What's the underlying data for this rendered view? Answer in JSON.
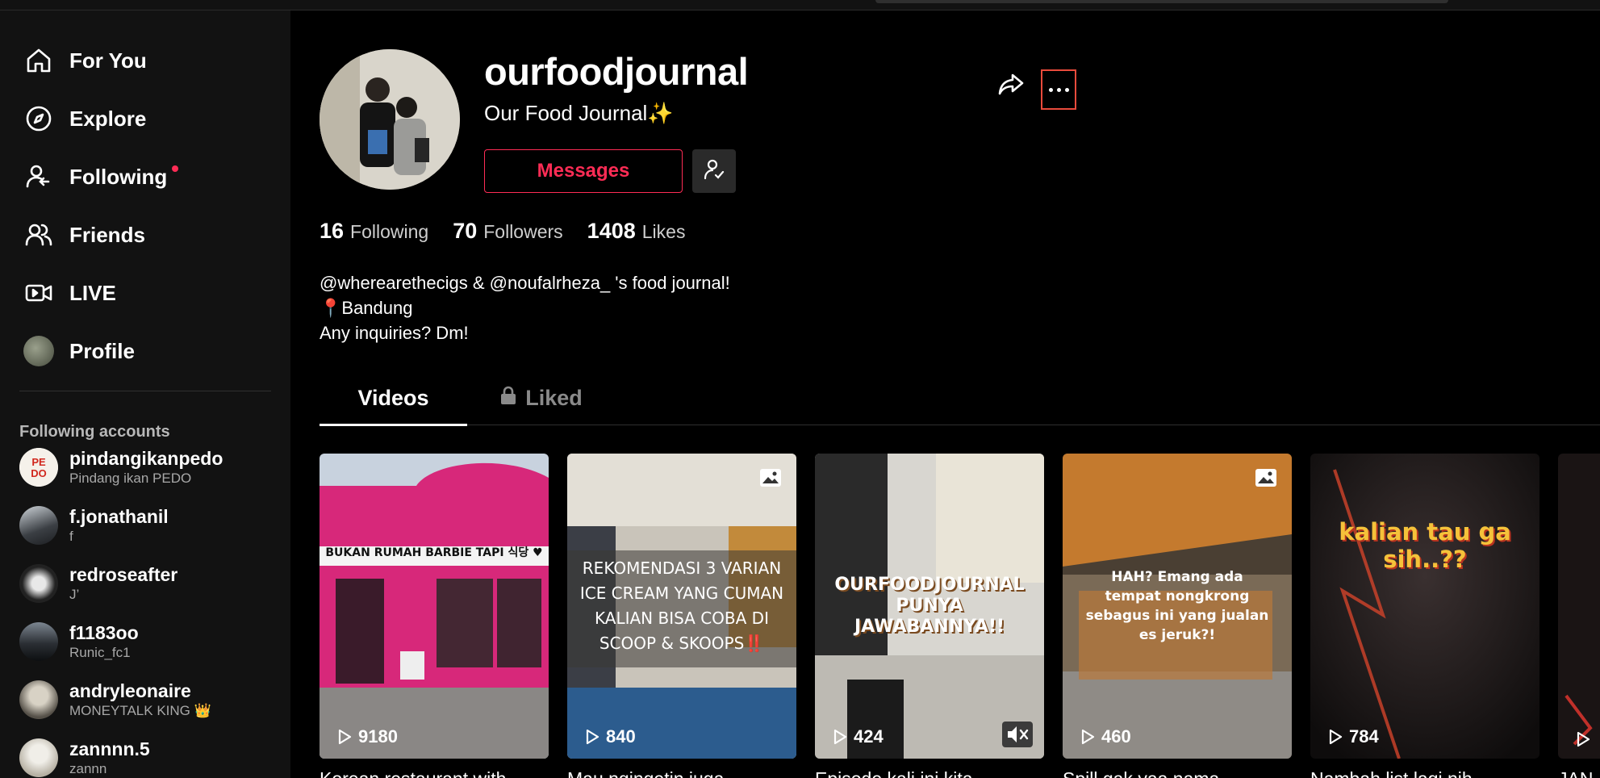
{
  "sidebar": {
    "nav": [
      {
        "label": "For You",
        "icon": "home-icon"
      },
      {
        "label": "Explore",
        "icon": "compass-icon"
      },
      {
        "label": "Following",
        "icon": "following-icon"
      },
      {
        "label": "Friends",
        "icon": "friends-icon"
      },
      {
        "label": "LIVE",
        "icon": "live-icon"
      },
      {
        "label": "Profile",
        "icon": "avatar"
      }
    ],
    "following_title": "Following accounts",
    "accounts": [
      {
        "name": "pindangikanpedo",
        "sub": "Pindang ikan PEDO"
      },
      {
        "name": "f.jonathanil",
        "sub": "f"
      },
      {
        "name": "redroseafter",
        "sub": "J’"
      },
      {
        "name": "f1183oo",
        "sub": "Runic_fc1"
      },
      {
        "name": "andryleonaire",
        "sub": "MONEYTALK KING 👑"
      },
      {
        "name": "zannnn.5",
        "sub": "zannn"
      }
    ]
  },
  "profile": {
    "username": "ourfoodjournal",
    "nickname": "Our Food Journal✨",
    "messages_label": "Messages",
    "stats": [
      {
        "value": "16",
        "label": "Following"
      },
      {
        "value": "70",
        "label": "Followers"
      },
      {
        "value": "1408",
        "label": "Likes"
      }
    ],
    "bio": [
      "@wherearethecigs & @noufalrheza_ 's food journal!",
      "📍Bandung",
      "Any inquiries? Dm!"
    ]
  },
  "tabs": [
    {
      "label": "Videos"
    },
    {
      "label": "Liked"
    }
  ],
  "videos": [
    {
      "views": "9180",
      "caption": "Korean restaurant with",
      "overlay": "BUKAN RUMAH BARBIE TAPI 식당 ♥",
      "photo": false,
      "muted": false
    },
    {
      "views": "840",
      "caption": "Mau ngingetin juga,",
      "overlay": "REKOMENDASI 3 VARIAN ICE CREAM YANG CUMAN KALIAN BISA COBA DI SCOOP & SKOOPS‼️",
      "photo": true,
      "muted": false
    },
    {
      "views": "424",
      "caption": "Episode kali ini kita",
      "overlay": "OURFOODJOURNAL PUNYA JAWABANNYA!!",
      "photo": false,
      "muted": true
    },
    {
      "views": "460",
      "caption": "Spill gak yaa nama",
      "overlay": "HAH? Emang ada tempat nongkrong sebagus ini yang jualan es jeruk?!",
      "photo": true,
      "muted": false
    },
    {
      "views": "784",
      "caption": "Nambah list lagi nih",
      "overlay": "kalian tau ga sih..??",
      "photo": false,
      "muted": false
    },
    {
      "views": "",
      "caption": "JAN",
      "overlay": "",
      "photo": false,
      "muted": false
    }
  ],
  "colors": {
    "accent": "#fe2c55",
    "sidebar_bg": "#121212",
    "focus_outline": "#e94b3c"
  }
}
